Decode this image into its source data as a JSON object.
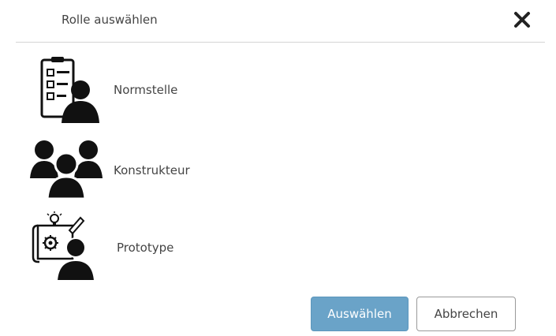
{
  "dialog": {
    "title": "Rolle auswählen",
    "close_icon": "close-icon"
  },
  "roles": [
    {
      "label": "Normstelle",
      "icon": "checklist-person-icon"
    },
    {
      "label": "Konstrukteur",
      "icon": "group-people-icon"
    },
    {
      "label": "Prototype",
      "icon": "blueprint-person-icon"
    }
  ],
  "buttons": {
    "select_label": "Auswählen",
    "cancel_label": "Abbrechen"
  },
  "colors": {
    "primary": "#6aa3c8",
    "icon": "#111111"
  }
}
